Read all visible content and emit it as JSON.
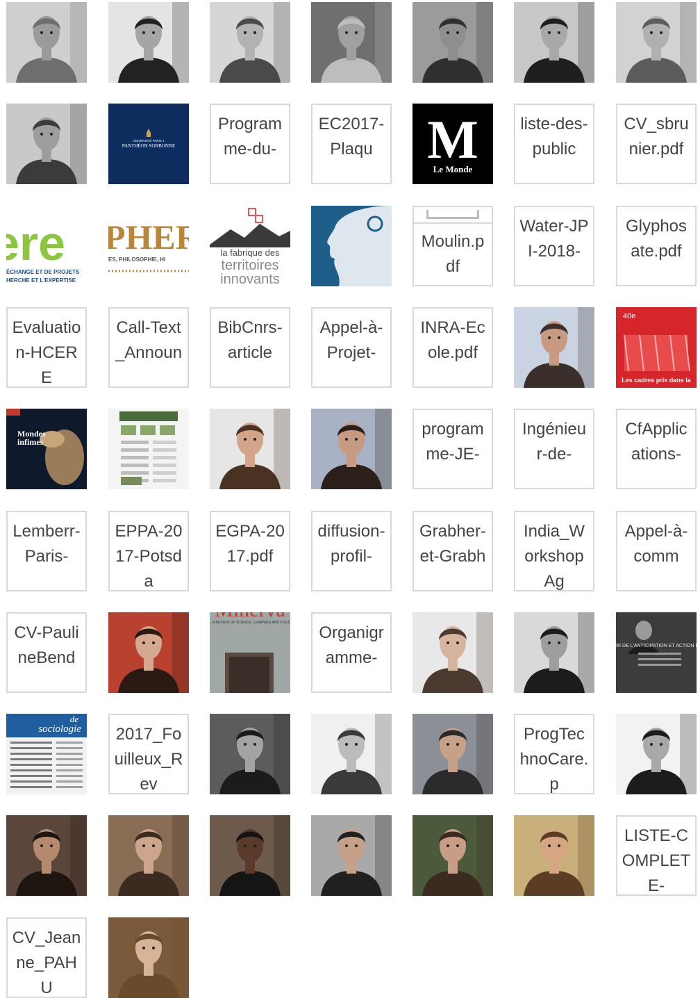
{
  "tiles": [
    {
      "kind": "photo",
      "alt": "portrait-man-curly-glasses",
      "tone": "#6e6e6e",
      "skin": "#9a9a9a",
      "bg": "#cfcfcf"
    },
    {
      "kind": "photo",
      "alt": "portrait-man-bald-beard",
      "tone": "#222222",
      "skin": "#a5a5a5",
      "bg": "#e4e4e4"
    },
    {
      "kind": "photo",
      "alt": "portrait-woman-glasses",
      "tone": "#4a4a4a",
      "skin": "#b3b3b3",
      "bg": "#d6d6d6"
    },
    {
      "kind": "photo",
      "alt": "portrait-older-woman",
      "tone": "#bdbdbd",
      "skin": "#a0a0a0",
      "bg": "#6f6f6f"
    },
    {
      "kind": "photo",
      "alt": "portrait-man-glasses",
      "tone": "#2f2f2f",
      "skin": "#8e8e8e",
      "bg": "#9b9b9b"
    },
    {
      "kind": "photo",
      "alt": "portrait-man-beard-dark",
      "tone": "#1f1f1f",
      "skin": "#a9a9a9",
      "bg": "#c8c8c8"
    },
    {
      "kind": "photo",
      "alt": "portrait-man-curly-hair",
      "tone": "#5c5c5c",
      "skin": "#b0b0b0",
      "bg": "#d2d2d2"
    },
    {
      "kind": "photo",
      "alt": "portrait-man-beard-white-shirt",
      "tone": "#3b3b3b",
      "skin": "#9d9d9d",
      "bg": "#c9c9c9"
    },
    {
      "kind": "logo",
      "alt": "pantheon-sorbonne-logo",
      "bg": "#0e2d5f",
      "line1": "UNIVERSITÉ PARIS 1",
      "line2": "PANTHÉON SORBONNE"
    },
    {
      "kind": "file",
      "name": "Programme-du-"
    },
    {
      "kind": "file",
      "name": "EC2017-Plaqu"
    },
    {
      "kind": "logo-m",
      "alt": "le-monde-logo",
      "bg": "#000000",
      "letter": "M",
      "sub": "Le Monde"
    },
    {
      "kind": "file",
      "name": "liste-des-public"
    },
    {
      "kind": "file",
      "name": "CV_sbrunier.pdf"
    },
    {
      "kind": "logo-ere",
      "alt": "ere-logo",
      "line1": "ÉCHANGE ET DE PROJETS",
      "line2": "HERCHE ET L'EXPERTISE"
    },
    {
      "kind": "logo-pher",
      "alt": "pher-logo",
      "line1": "ES, PHILOSOPHIE, HI"
    },
    {
      "kind": "logo-fabrique",
      "alt": "fabrique-territoires-logo",
      "line1": "la fabrique des",
      "line2": "territoires",
      "line3": "innovants"
    },
    {
      "kind": "art",
      "alt": "blue-head-illustration",
      "bg": "#1d5f8a",
      "fg": "#0c2740"
    },
    {
      "kind": "file-doc",
      "name": "Moulin.pdf"
    },
    {
      "kind": "file",
      "name": "Water-JPI-2018-"
    },
    {
      "kind": "file",
      "name": "Glyphosate.pdf"
    },
    {
      "kind": "file",
      "name": "Evaluation-HCERE"
    },
    {
      "kind": "file",
      "name": "Call-Text_Announ"
    },
    {
      "kind": "file",
      "name": "BibCnrs-article"
    },
    {
      "kind": "file",
      "name": "Appel-à-Projet-"
    },
    {
      "kind": "file",
      "name": "INRA-Ecole.pdf"
    },
    {
      "kind": "photo",
      "alt": "portrait-man-id-photo",
      "tone": "#3a2f2a",
      "skin": "#c99a82",
      "bg": "#c9d3e2"
    },
    {
      "kind": "cover-red",
      "alt": "magazine-cover-red",
      "bg": "#d7262b",
      "top": "40e",
      "caption": "Les cadres pris dans la"
    },
    {
      "kind": "cover-dark",
      "alt": "book-cover-mondes-infimes",
      "bg": "#0e1a2b",
      "title1": "Mondes",
      "title2": "infimes"
    },
    {
      "kind": "web",
      "alt": "website-screenshot"
    },
    {
      "kind": "photo",
      "alt": "portrait-young-man",
      "tone": "#4a3222",
      "skin": "#d2a48a",
      "bg": "#e6e6e6"
    },
    {
      "kind": "photo",
      "alt": "portrait-man-dark-hair",
      "tone": "#2a1f19",
      "skin": "#c79b82",
      "bg": "#a9b2c4"
    },
    {
      "kind": "file",
      "name": "programme-JE-"
    },
    {
      "kind": "file",
      "name": "Ingénieur-de-"
    },
    {
      "kind": "file",
      "name": "CfApplications-"
    },
    {
      "kind": "file",
      "name": "Lemberr-Paris-"
    },
    {
      "kind": "file",
      "name": "EPPA-2017-Potsda"
    },
    {
      "kind": "file",
      "name": "EGPA-2017.pdf"
    },
    {
      "kind": "file",
      "name": "diffusion-profil-"
    },
    {
      "kind": "file",
      "name": "Grabher-et-Grabh"
    },
    {
      "kind": "file",
      "name": "India_WorkshopAg"
    },
    {
      "kind": "file",
      "name": "Appel-à-comm"
    },
    {
      "kind": "file",
      "name": "CV-PaulineBend"
    },
    {
      "kind": "photo",
      "alt": "portrait-woman-bookshelf",
      "tone": "#2b1a14",
      "skin": "#d4a98f",
      "bg": "#b8412f"
    },
    {
      "kind": "cover-minerva",
      "alt": "minerva-journal-cover",
      "bg": "#9fa8a4",
      "title": "Minerva",
      "sub": "A REVIEW OF SCIENCE, LEARNING AND POLICY"
    },
    {
      "kind": "file",
      "name": "Organigramme-"
    },
    {
      "kind": "photo",
      "alt": "portrait-woman-glasses-smiling",
      "tone": "#4a3a30",
      "skin": "#d6b49e",
      "bg": "#e8e8e8"
    },
    {
      "kind": "photo",
      "alt": "portrait-man-black-white",
      "tone": "#1c1c1c",
      "skin": "#9e9e9e",
      "bg": "#d9d9d9"
    },
    {
      "kind": "cover-anticipation",
      "alt": "book-cover-anticipation",
      "bg": "#3c3c3c",
      "caption": "IR DE L'ANTICIPATION ET ACTION PUBLIQUE"
    },
    {
      "kind": "cover-socio",
      "alt": "revue-sociologie-cover",
      "top": "de",
      "title": "sociologie"
    },
    {
      "kind": "file",
      "name": "2017_Fouilleux_Rev"
    },
    {
      "kind": "photo",
      "alt": "portrait-man-glasses-bw",
      "tone": "#1b1b1b",
      "skin": "#a3a3a3",
      "bg": "#5c5c5c"
    },
    {
      "kind": "photo",
      "alt": "portrait-man-glasses-light",
      "tone": "#3a3a3a",
      "skin": "#bcbcbc",
      "bg": "#f0f0f0"
    },
    {
      "kind": "photo",
      "alt": "portrait-man-speaking",
      "tone": "#2b2b2b",
      "skin": "#c6a087",
      "bg": "#8c8f96"
    },
    {
      "kind": "file",
      "name": "ProgTechnoCare.p"
    },
    {
      "kind": "photo",
      "alt": "portrait-man-sweater",
      "tone": "#1c1c1c",
      "skin": "#a8a8a8",
      "bg": "#f2f2f2"
    },
    {
      "kind": "photo",
      "alt": "portrait-woman-curly",
      "tone": "#1e1410",
      "skin": "#b58a6e",
      "bg": "#5a463b"
    },
    {
      "kind": "photo",
      "alt": "portrait-man-bookshelf",
      "tone": "#3a2a20",
      "skin": "#cda48c",
      "bg": "#8a6d55"
    },
    {
      "kind": "photo",
      "alt": "portrait-man-suit",
      "tone": "#151515",
      "skin": "#5a3b2a",
      "bg": "#6e5a4a"
    },
    {
      "kind": "photo",
      "alt": "portrait-man-office",
      "tone": "#202020",
      "skin": "#c7a08a",
      "bg": "#a9a9a9"
    },
    {
      "kind": "photo",
      "alt": "portrait-man-smiling",
      "tone": "#3a2a20",
      "skin": "#c79d85",
      "bg": "#4b5a3a"
    },
    {
      "kind": "photo",
      "alt": "portrait-woman-glasses-outdoor",
      "tone": "#5a3d24",
      "skin": "#d6a683",
      "bg": "#c9b07a"
    },
    {
      "kind": "file",
      "name": "LISTE-COMPLETE-"
    },
    {
      "kind": "file",
      "name": "CV_Jeanne_PAHU"
    },
    {
      "kind": "photo",
      "alt": "portrait-woman-library",
      "tone": "#6a4a2a",
      "skin": "#d7b39a",
      "bg": "#7a5a3a"
    }
  ]
}
